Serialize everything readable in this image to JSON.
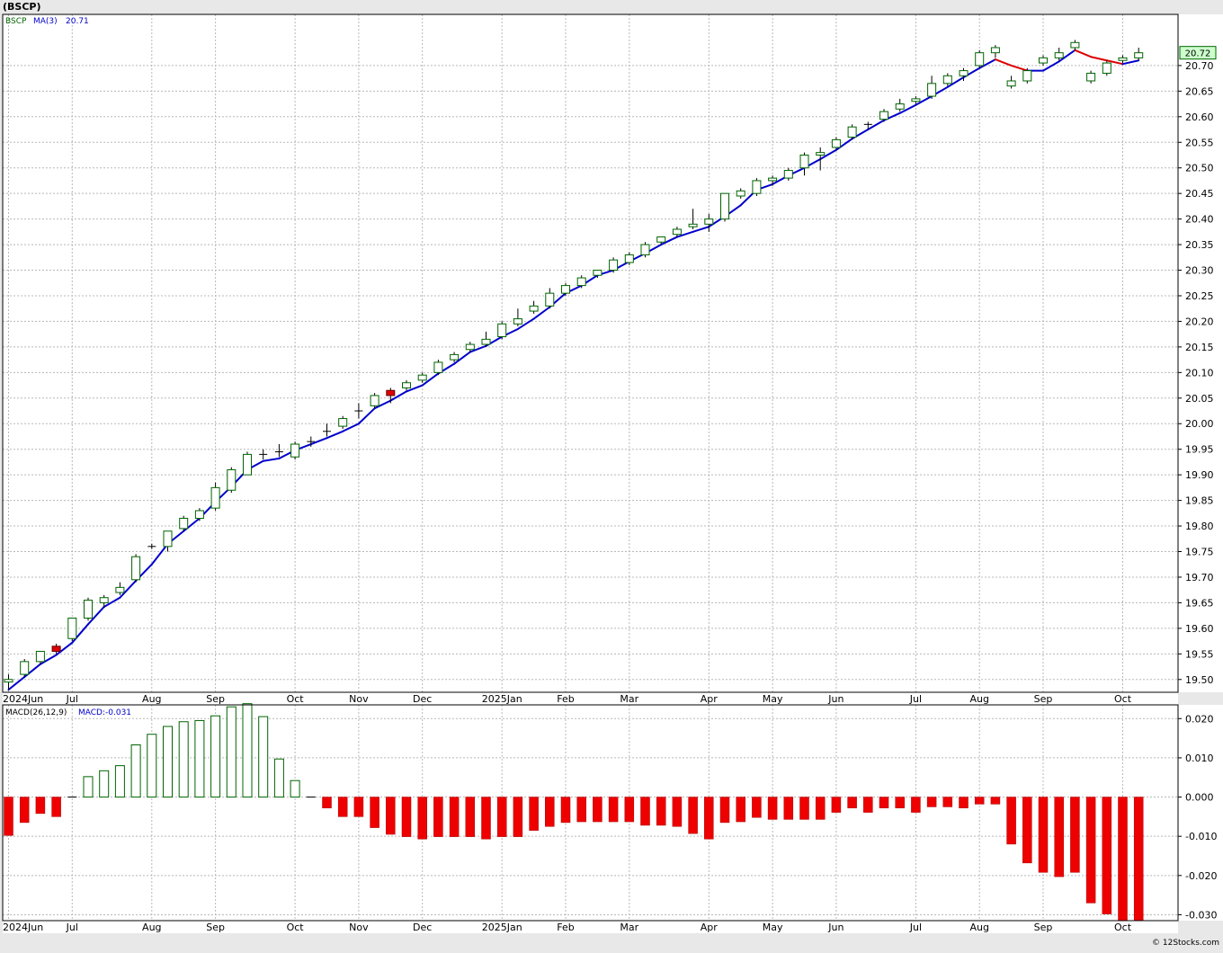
{
  "header": {
    "symbol": "(BSCP)",
    "legend_symbol": "BSCP",
    "legend_ma": "MA(3)",
    "legend_ma_value": "20.71",
    "last_price_label": "20.72",
    "macd_label": "MACD(26,12,9)",
    "macd_value_label": "MACD:-0.031",
    "copyright": "© 12Stocks.com"
  },
  "colors": {
    "up_candle_fill": "#ffffff",
    "candle_stroke": "#006400",
    "down_candle_fill": "#dd0000",
    "ma_rising": "#0000cc",
    "ma_falling": "#dd0000",
    "macd_positive_stroke": "#006400",
    "macd_negative_fill": "#ee0000",
    "price_tag_fill": "#ccffcc",
    "grid": "#b8b8b8"
  },
  "chart_data": [
    {
      "type": "candlestick",
      "title": "(BSCP)",
      "ylim": [
        19.475,
        20.8
      ],
      "y_ticks": [
        "19.50",
        "19.55",
        "19.60",
        "19.65",
        "19.70",
        "19.75",
        "19.80",
        "19.85",
        "19.90",
        "19.95",
        "20.00",
        "20.05",
        "20.10",
        "20.15",
        "20.20",
        "20.25",
        "20.30",
        "20.35",
        "20.40",
        "20.45",
        "20.50",
        "20.55",
        "20.60",
        "20.65",
        "20.70"
      ],
      "x_ticks": [
        {
          "label": "2024Jun",
          "week": 0
        },
        {
          "label": "Jul",
          "week": 4
        },
        {
          "label": "Aug",
          "week": 9
        },
        {
          "label": "Sep",
          "week": 13
        },
        {
          "label": "Oct",
          "week": 18
        },
        {
          "label": "Nov",
          "week": 22
        },
        {
          "label": "Dec",
          "week": 26
        },
        {
          "label": "2025Jan",
          "week": 31
        },
        {
          "label": "Feb",
          "week": 35
        },
        {
          "label": "Mar",
          "week": 39
        },
        {
          "label": "Apr",
          "week": 44
        },
        {
          "label": "May",
          "week": 48
        },
        {
          "label": "Jun",
          "week": 52
        },
        {
          "label": "Jul",
          "week": 57
        },
        {
          "label": "Aug",
          "week": 61
        },
        {
          "label": "Sep",
          "week": 65
        },
        {
          "label": "Oct",
          "week": 70
        }
      ],
      "candles": [
        {
          "o": 19.495,
          "h": 19.51,
          "l": 19.48,
          "c": 19.5
        },
        {
          "o": 19.51,
          "h": 19.54,
          "l": 19.505,
          "c": 19.535
        },
        {
          "o": 19.535,
          "h": 19.555,
          "l": 19.53,
          "c": 19.555
        },
        {
          "o": 19.565,
          "h": 19.57,
          "l": 19.55,
          "c": 19.555
        },
        {
          "o": 19.58,
          "h": 19.62,
          "l": 19.575,
          "c": 19.62
        },
        {
          "o": 19.62,
          "h": 19.66,
          "l": 19.615,
          "c": 19.655
        },
        {
          "o": 19.65,
          "h": 19.665,
          "l": 19.64,
          "c": 19.66
        },
        {
          "o": 19.67,
          "h": 19.69,
          "l": 19.665,
          "c": 19.68
        },
        {
          "o": 19.695,
          "h": 19.745,
          "l": 19.69,
          "c": 19.74
        },
        {
          "o": 19.76,
          "h": 19.765,
          "l": 19.755,
          "c": 19.76
        },
        {
          "o": 19.76,
          "h": 19.79,
          "l": 19.75,
          "c": 19.79
        },
        {
          "o": 19.795,
          "h": 19.82,
          "l": 19.79,
          "c": 19.815
        },
        {
          "o": 19.815,
          "h": 19.835,
          "l": 19.81,
          "c": 19.83
        },
        {
          "o": 19.835,
          "h": 19.885,
          "l": 19.83,
          "c": 19.875
        },
        {
          "o": 19.87,
          "h": 19.915,
          "l": 19.865,
          "c": 19.91
        },
        {
          "o": 19.9,
          "h": 19.945,
          "l": 19.9,
          "c": 19.94
        },
        {
          "o": 19.94,
          "h": 19.95,
          "l": 19.93,
          "c": 19.94
        },
        {
          "o": 19.945,
          "h": 19.96,
          "l": 19.935,
          "c": 19.945
        },
        {
          "o": 19.935,
          "h": 19.965,
          "l": 19.93,
          "c": 19.96
        },
        {
          "o": 19.965,
          "h": 19.975,
          "l": 19.955,
          "c": 19.965
        },
        {
          "o": 19.985,
          "h": 20.0,
          "l": 19.975,
          "c": 19.985
        },
        {
          "o": 19.995,
          "h": 20.015,
          "l": 19.99,
          "c": 20.01
        },
        {
          "o": 20.025,
          "h": 20.04,
          "l": 20.01,
          "c": 20.025
        },
        {
          "o": 20.035,
          "h": 20.06,
          "l": 20.03,
          "c": 20.055
        },
        {
          "o": 20.065,
          "h": 20.07,
          "l": 20.04,
          "c": 20.055
        },
        {
          "o": 20.07,
          "h": 20.085,
          "l": 20.065,
          "c": 20.08
        },
        {
          "o": 20.085,
          "h": 20.1,
          "l": 20.08,
          "c": 20.095
        },
        {
          "o": 20.1,
          "h": 20.125,
          "l": 20.095,
          "c": 20.12
        },
        {
          "o": 20.125,
          "h": 20.14,
          "l": 20.12,
          "c": 20.135
        },
        {
          "o": 20.145,
          "h": 20.16,
          "l": 20.14,
          "c": 20.155
        },
        {
          "o": 20.155,
          "h": 20.18,
          "l": 20.15,
          "c": 20.165
        },
        {
          "o": 20.17,
          "h": 20.2,
          "l": 20.165,
          "c": 20.195
        },
        {
          "o": 20.195,
          "h": 20.225,
          "l": 20.19,
          "c": 20.205
        },
        {
          "o": 20.22,
          "h": 20.24,
          "l": 20.215,
          "c": 20.23
        },
        {
          "o": 20.23,
          "h": 20.265,
          "l": 20.225,
          "c": 20.255
        },
        {
          "o": 20.255,
          "h": 20.275,
          "l": 20.25,
          "c": 20.27
        },
        {
          "o": 20.27,
          "h": 20.29,
          "l": 20.265,
          "c": 20.285
        },
        {
          "o": 20.29,
          "h": 20.3,
          "l": 20.285,
          "c": 20.3
        },
        {
          "o": 20.3,
          "h": 20.325,
          "l": 20.295,
          "c": 20.32
        },
        {
          "o": 20.315,
          "h": 20.335,
          "l": 20.31,
          "c": 20.33
        },
        {
          "o": 20.33,
          "h": 20.355,
          "l": 20.325,
          "c": 20.35
        },
        {
          "o": 20.355,
          "h": 20.365,
          "l": 20.35,
          "c": 20.365
        },
        {
          "o": 20.37,
          "h": 20.385,
          "l": 20.365,
          "c": 20.38
        },
        {
          "o": 20.385,
          "h": 20.42,
          "l": 20.38,
          "c": 20.39
        },
        {
          "o": 20.39,
          "h": 20.41,
          "l": 20.375,
          "c": 20.4
        },
        {
          "o": 20.4,
          "h": 20.45,
          "l": 20.395,
          "c": 20.45
        },
        {
          "o": 20.445,
          "h": 20.46,
          "l": 20.44,
          "c": 20.455
        },
        {
          "o": 20.45,
          "h": 20.48,
          "l": 20.445,
          "c": 20.475
        },
        {
          "o": 20.475,
          "h": 20.485,
          "l": 20.465,
          "c": 20.48
        },
        {
          "o": 20.48,
          "h": 20.5,
          "l": 20.475,
          "c": 20.495
        },
        {
          "o": 20.5,
          "h": 20.53,
          "l": 20.485,
          "c": 20.525
        },
        {
          "o": 20.525,
          "h": 20.54,
          "l": 20.495,
          "c": 20.53
        },
        {
          "o": 20.54,
          "h": 20.56,
          "l": 20.535,
          "c": 20.555
        },
        {
          "o": 20.56,
          "h": 20.585,
          "l": 20.555,
          "c": 20.58
        },
        {
          "o": 20.585,
          "h": 20.59,
          "l": 20.575,
          "c": 20.585
        },
        {
          "o": 20.595,
          "h": 20.615,
          "l": 20.59,
          "c": 20.61
        },
        {
          "o": 20.615,
          "h": 20.635,
          "l": 20.61,
          "c": 20.625
        },
        {
          "o": 20.63,
          "h": 20.64,
          "l": 20.625,
          "c": 20.635
        },
        {
          "o": 20.64,
          "h": 20.68,
          "l": 20.635,
          "c": 20.665
        },
        {
          "o": 20.665,
          "h": 20.685,
          "l": 20.66,
          "c": 20.68
        },
        {
          "o": 20.68,
          "h": 20.695,
          "l": 20.67,
          "c": 20.69
        },
        {
          "o": 20.7,
          "h": 20.73,
          "l": 20.695,
          "c": 20.725
        },
        {
          "o": 20.725,
          "h": 20.74,
          "l": 20.715,
          "c": 20.735
        },
        {
          "o": 20.66,
          "h": 20.68,
          "l": 20.655,
          "c": 20.67
        },
        {
          "o": 20.67,
          "h": 20.695,
          "l": 20.665,
          "c": 20.69
        },
        {
          "o": 20.705,
          "h": 20.72,
          "l": 20.7,
          "c": 20.715
        },
        {
          "o": 20.715,
          "h": 20.735,
          "l": 20.71,
          "c": 20.725
        },
        {
          "o": 20.735,
          "h": 20.75,
          "l": 20.73,
          "c": 20.745
        },
        {
          "o": 20.67,
          "h": 20.69,
          "l": 20.665,
          "c": 20.685
        },
        {
          "o": 20.685,
          "h": 20.71,
          "l": 20.68,
          "c": 20.705
        },
        {
          "o": 20.71,
          "h": 20.72,
          "l": 20.705,
          "c": 20.715
        },
        {
          "o": 20.715,
          "h": 20.735,
          "l": 20.71,
          "c": 20.725
        }
      ],
      "ma3": [
        19.48,
        19.505,
        19.53,
        19.548,
        19.572,
        19.608,
        19.642,
        19.66,
        19.693,
        19.725,
        19.765,
        19.79,
        19.815,
        19.847,
        19.877,
        19.91,
        19.927,
        19.932,
        19.948,
        19.96,
        19.972,
        19.985,
        20.0,
        20.03,
        20.045,
        20.063,
        20.075,
        20.098,
        20.117,
        20.14,
        20.152,
        20.17,
        20.185,
        20.205,
        20.228,
        20.255,
        20.27,
        20.29,
        20.3,
        20.317,
        20.333,
        20.35,
        20.365,
        20.375,
        20.385,
        20.405,
        20.427,
        20.457,
        20.468,
        20.485,
        20.5,
        20.517,
        20.535,
        20.557,
        20.575,
        20.593,
        20.607,
        20.623,
        20.64,
        20.658,
        20.677,
        20.695,
        20.712,
        20.7,
        20.69,
        20.69,
        20.708,
        20.73,
        20.717,
        20.71,
        20.703,
        20.71
      ]
    },
    {
      "type": "bar",
      "title": "MACD(26,12,9)",
      "ylim": [
        -0.0315,
        0.0235
      ],
      "y_ticks": [
        "0.020",
        "0.010",
        "0.000",
        "-0.010",
        "-0.020",
        "-0.030"
      ],
      "values": [
        -0.0098,
        -0.0065,
        -0.0042,
        -0.005,
        -0.0002,
        0.0052,
        0.0067,
        0.008,
        0.0133,
        0.016,
        0.018,
        0.0192,
        0.0195,
        0.0207,
        0.023,
        0.0238,
        0.0205,
        0.0097,
        0.0042,
        0.0003,
        -0.0028,
        -0.005,
        -0.005,
        -0.0078,
        -0.0095,
        -0.0101,
        -0.0107,
        -0.0101,
        -0.0101,
        -0.0101,
        -0.0107,
        -0.0101,
        -0.0101,
        -0.0085,
        -0.0075,
        -0.0065,
        -0.0063,
        -0.0063,
        -0.0063,
        -0.0063,
        -0.0072,
        -0.0072,
        -0.0075,
        -0.0093,
        -0.0107,
        -0.0065,
        -0.0063,
        -0.0052,
        -0.0057,
        -0.0057,
        -0.0057,
        -0.0057,
        -0.0039,
        -0.0028,
        -0.0039,
        -0.0028,
        -0.0028,
        -0.0039,
        -0.0025,
        -0.0025,
        -0.0028,
        -0.0018,
        -0.0018,
        -0.012,
        -0.0168,
        -0.0192,
        -0.0203,
        -0.0192,
        -0.027,
        -0.0298,
        -0.0315,
        -0.0315
      ]
    }
  ]
}
